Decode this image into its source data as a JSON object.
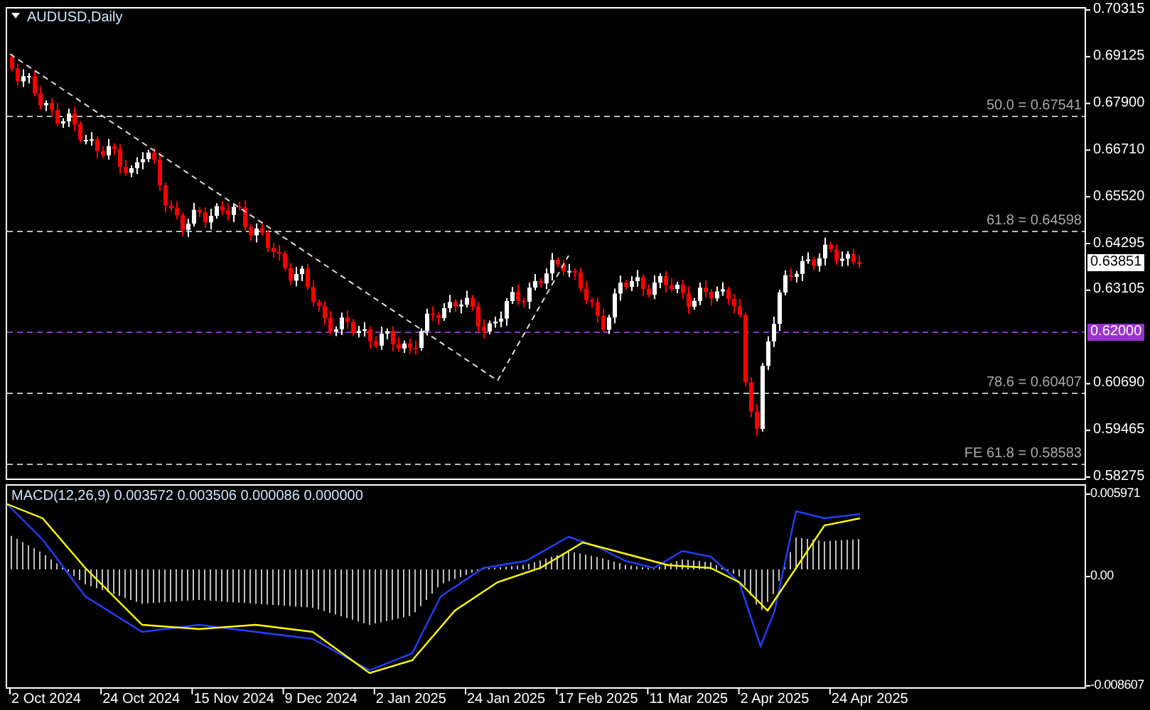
{
  "chart": {
    "title": "AUDUSD,Daily",
    "price_axis": [
      "0.70315",
      "0.69125",
      "0.67900",
      "0.66710",
      "0.65520",
      "0.64295",
      "0.63105",
      "0.60690",
      "0.59465",
      "0.58275"
    ],
    "levels": [
      {
        "kind": "fib",
        "label": "50.0 = 0.67541"
      },
      {
        "kind": "fib",
        "label": "61.8 = 0.64598"
      },
      {
        "kind": "alert",
        "label": "0.62000",
        "color": "#9933cc"
      },
      {
        "kind": "fib",
        "label": "78.6 = 0.60407"
      },
      {
        "kind": "fib",
        "label": "FE 61.8 = 0.58583"
      }
    ],
    "current_price": "0.63851"
  },
  "indicator": {
    "label": "MACD(12,26,9) 0.003572 0.003506 0.000086 0.000000",
    "axis": [
      "0.005971",
      "0.00",
      "-0.008607"
    ]
  },
  "date_axis": [
    "2 Oct 2024",
    "24 Oct 2024",
    "15 Nov 2024",
    "9 Dec 2024",
    "2 Jan 2025",
    "24 Jan 2025",
    "17 Feb 2025",
    "11 Mar 2025",
    "2 Apr 2025",
    "24 Apr 2025"
  ]
}
